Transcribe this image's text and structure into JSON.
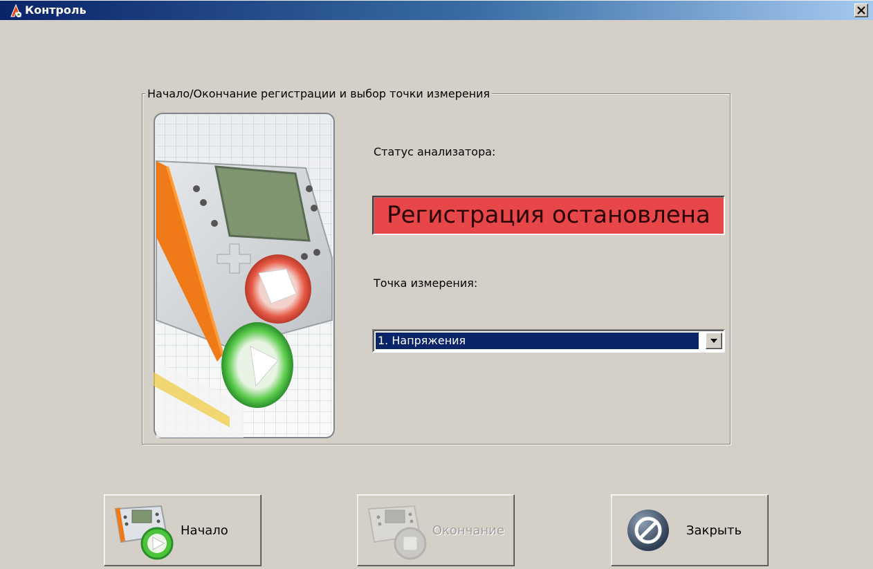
{
  "window": {
    "title": "Контроль"
  },
  "group": {
    "legend": "Начало/Окончание регистрации и выбор точки измерения"
  },
  "status": {
    "label": "Статус анализатора:",
    "value": "Регистрация остановлена",
    "color": "#e8474a"
  },
  "measurement_point": {
    "label": "Точка измерения:",
    "selected": "1. Напряжения"
  },
  "buttons": {
    "start": {
      "label": "Начало",
      "icon": "analyzer-start-icon",
      "enabled": true
    },
    "stop": {
      "label": "Окончание",
      "icon": "analyzer-stop-icon",
      "enabled": false
    },
    "close": {
      "label": "Закрыть",
      "icon": "close-circle-icon",
      "enabled": true
    }
  },
  "colors": {
    "titlebar_start": "#0a246a",
    "titlebar_end": "#a6caf0",
    "window_bg": "#d4d0c8",
    "selection": "#0a246a"
  }
}
